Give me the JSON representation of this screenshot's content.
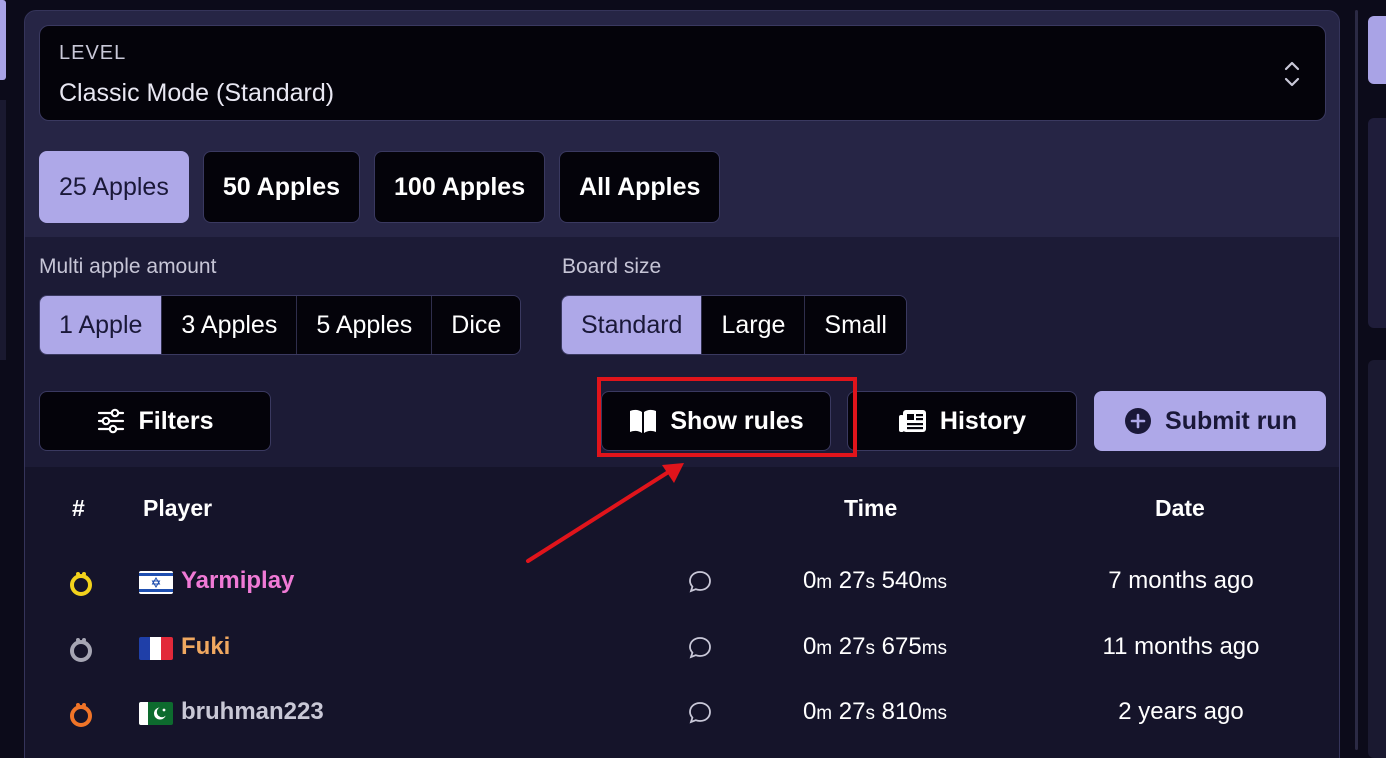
{
  "level": {
    "label": "LEVEL",
    "value": "Classic Mode (Standard)"
  },
  "apple_tabs": [
    {
      "label": "25 Apples",
      "active": true
    },
    {
      "label": "50 Apples",
      "active": false
    },
    {
      "label": "100 Apples",
      "active": false
    },
    {
      "label": "All Apples",
      "active": false
    }
  ],
  "multi_apple": {
    "label": "Multi apple amount",
    "options": [
      {
        "label": "1 Apple",
        "active": true
      },
      {
        "label": "3 Apples",
        "active": false
      },
      {
        "label": "5 Apples",
        "active": false
      },
      {
        "label": "Dice",
        "active": false
      }
    ]
  },
  "board_size": {
    "label": "Board size",
    "options": [
      {
        "label": "Standard",
        "active": true
      },
      {
        "label": "Large",
        "active": false
      },
      {
        "label": "Small",
        "active": false
      }
    ]
  },
  "actions": {
    "filters": "Filters",
    "show_rules": "Show rules",
    "history": "History",
    "submit_run": "Submit run"
  },
  "table": {
    "headers": {
      "rank": "#",
      "player": "Player",
      "time": "Time",
      "date": "Date"
    },
    "rows": [
      {
        "rank_icon": "gold-medal-icon",
        "rank_color": "#f2d21c",
        "flag": "israel-flag-icon",
        "player": "Yarmiplay",
        "player_color": "#f07ad6",
        "time_m": "0",
        "time_s": "27",
        "time_ms": "540",
        "date": "7 months ago"
      },
      {
        "rank_icon": "silver-medal-icon",
        "rank_color": "#a6a6b4",
        "flag": "france-flag-icon",
        "player": "Fuki",
        "player_color": "#f0a860",
        "time_m": "0",
        "time_s": "27",
        "time_ms": "675",
        "date": "11 months ago"
      },
      {
        "rank_icon": "bronze-medal-icon",
        "rank_color": "#f07428",
        "flag": "pakistan-flag-icon",
        "player": "bruhman223",
        "player_color": "#c9c8d6",
        "time_m": "0",
        "time_s": "27",
        "time_ms": "810",
        "date": "2 years ago"
      }
    ],
    "units": {
      "m": "m",
      "s": "s",
      "ms": "ms"
    }
  },
  "annotation_color": "#e0141b"
}
